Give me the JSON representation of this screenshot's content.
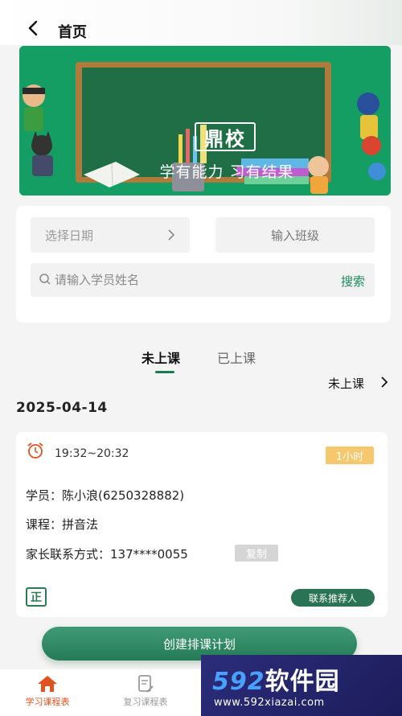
{
  "header": {
    "title": "首页"
  },
  "banner": {
    "logo_text": "鼎校",
    "slogan": "学有能力 习有结果"
  },
  "filters": {
    "date_placeholder": "选择日期",
    "class_placeholder": "输入班级",
    "student_placeholder": "请输入学员姓名",
    "search_label": "搜索"
  },
  "tabs": [
    {
      "label": "未上课",
      "active": true
    },
    {
      "label": "已上课",
      "active": false
    }
  ],
  "status_filter": "未上课",
  "date_heading": "2025-04-14",
  "lesson": {
    "time": "19:32~20:32",
    "duration": "1小时",
    "student": "学员：陈小浪(6250328882)",
    "course": "课程：拼音法",
    "contact": "家长联系方式：137****0055",
    "copy_label": "复制",
    "status_tag": "正",
    "contact_referrer_label": "联系推荐人"
  },
  "create_plan_label": "创建排课计划",
  "bottom_nav": [
    {
      "label": "学习课程表",
      "active": true
    },
    {
      "label": "复习课程表",
      "active": false
    }
  ],
  "watermark": {
    "main_prefix": "592",
    "main_suffix": "软件园",
    "url": "www.592xiazai.com"
  },
  "colors": {
    "primary": "#1a7b52",
    "banner_green": "#149e63",
    "badge_yellow": "#f5c86e",
    "nav_active": "#e0531f"
  }
}
